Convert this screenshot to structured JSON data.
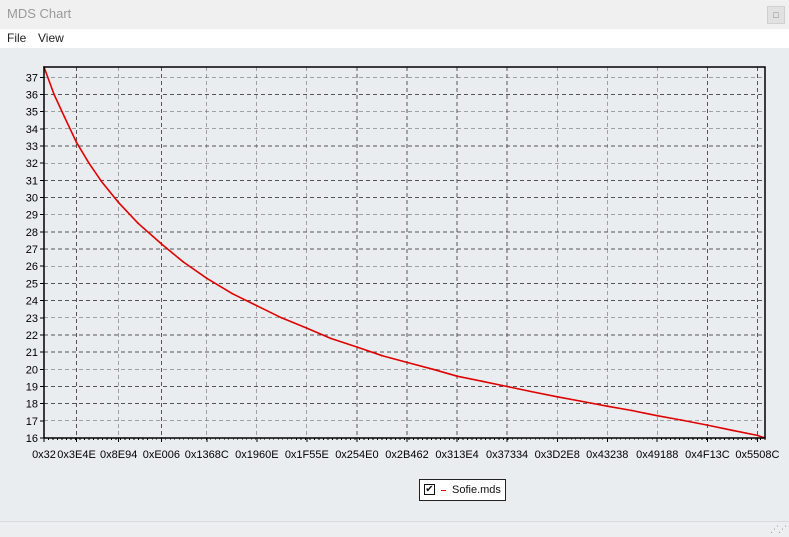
{
  "window": {
    "title": "MDS Chart",
    "close_icon": "□"
  },
  "menu": {
    "items": [
      {
        "label": "File"
      },
      {
        "label": "View"
      }
    ]
  },
  "colors": {
    "series": "#e00000",
    "plot_background": "#e9edf0",
    "grid": "#555555",
    "axis": "#000000"
  },
  "legend": {
    "checked": true,
    "check_mark": "✔",
    "label": "Sofie.mds"
  },
  "chart_data": {
    "type": "line",
    "x_tick_labels": [
      "0x32",
      "0x3E4E",
      "0x8E94",
      "0xE006",
      "0x1368C",
      "0x1960E",
      "0x1F55E",
      "0x254E0",
      "0x2B462",
      "0x313E4",
      "0x37334",
      "0x3D2E8",
      "0x43238",
      "0x49188",
      "0x4F13C",
      "0x5508C"
    ],
    "x_tick_values": [
      50,
      15950,
      36500,
      57350,
      79500,
      103950,
      128350,
      152800,
      177250,
      201700,
      226100,
      250600,
      274998,
      299400,
      323900,
      348300
    ],
    "y_ticks": [
      16,
      17,
      18,
      19,
      20,
      21,
      22,
      23,
      24,
      25,
      26,
      27,
      28,
      29,
      30,
      31,
      32,
      33,
      34,
      35,
      36,
      37
    ],
    "xlim": [
      50,
      352000
    ],
    "ylim": [
      16,
      37.6
    ],
    "grid": true,
    "legend_position": "bottom-center",
    "series": [
      {
        "name": "Sofie.mds",
        "x": [
          50,
          5000,
          10000,
          15950,
          22000,
          28000,
          36500,
          46000,
          57350,
          68000,
          79500,
          92000,
          103950,
          116000,
          128350,
          140000,
          152800,
          165000,
          177250,
          190000,
          201700,
          214000,
          226100,
          238000,
          250600,
          262000,
          274998,
          287000,
          299400,
          311000,
          323900,
          336000,
          348300,
          352000
        ],
        "y": [
          37.6,
          36.0,
          34.7,
          33.2,
          32.0,
          30.95,
          29.7,
          28.5,
          27.3,
          26.25,
          25.3,
          24.4,
          23.7,
          23.0,
          22.4,
          21.8,
          21.3,
          20.8,
          20.4,
          20.0,
          19.6,
          19.3,
          19.0,
          18.7,
          18.4,
          18.15,
          17.85,
          17.6,
          17.3,
          17.05,
          16.75,
          16.45,
          16.15,
          16.0
        ]
      }
    ]
  }
}
